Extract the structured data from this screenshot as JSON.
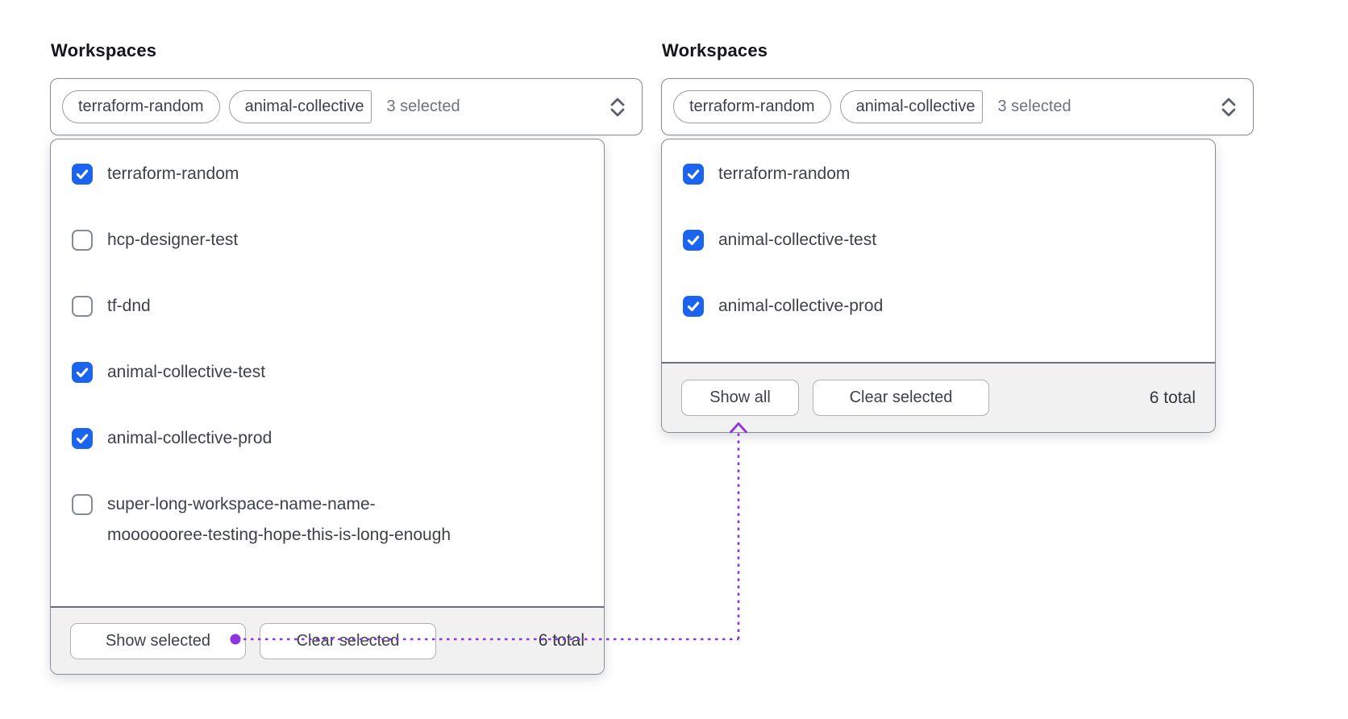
{
  "colors": {
    "checkbox_checked_blue": "#1b64f2",
    "annotation_purple": "#8f35e0",
    "footer_background": "#f1f1f2",
    "panel_border": "#878c95"
  },
  "left": {
    "title": "Workspaces",
    "select": {
      "tags": [
        "terraform-random",
        "animal-collective"
      ],
      "count_label": "3 selected",
      "chevron_icon": "chevron-up-down"
    },
    "options": [
      {
        "label": "terraform-random",
        "checked": true
      },
      {
        "label": "hcp-designer-test",
        "checked": false
      },
      {
        "label": "tf-dnd",
        "checked": false
      },
      {
        "label": "animal-collective-test",
        "checked": true
      },
      {
        "label": "animal-collective-prod",
        "checked": true
      },
      {
        "label": "super-long-workspace-name-name-mooooooree-testing-hope-this-is-long-enough",
        "checked": false,
        "lines": [
          "super-long-workspace-name-name-",
          "mooooooree-testing-hope-this-is-long-enough"
        ]
      }
    ],
    "footer": {
      "show_button": "Show selected",
      "clear_button": "Clear selected",
      "total_label": "6 total"
    }
  },
  "right": {
    "title": "Workspaces",
    "select": {
      "tags": [
        "terraform-random",
        "animal-collective"
      ],
      "count_label": "3 selected",
      "chevron_icon": "chevron-up-down"
    },
    "options": [
      {
        "label": "terraform-random",
        "checked": true
      },
      {
        "label": "animal-collective-test",
        "checked": true
      },
      {
        "label": "animal-collective-prod",
        "checked": true
      }
    ],
    "footer": {
      "show_button": "Show all",
      "clear_button": "Clear selected",
      "total_label": "6 total"
    }
  },
  "annotation": {
    "meaning": "clicking Show selected leads to filtered state",
    "from": "show-selected-button",
    "to": "show-all-button"
  }
}
